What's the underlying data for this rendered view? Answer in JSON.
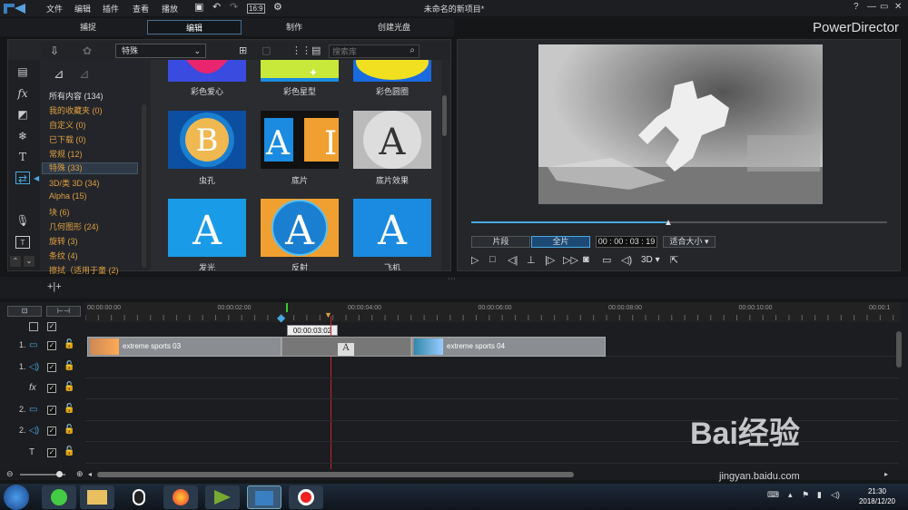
{
  "menu": {
    "file": "文件",
    "edit": "编辑",
    "plugins": "插件",
    "view": "查看",
    "playback": "播放"
  },
  "title": "未命名的新项目*",
  "window_controls": [
    "?",
    "—",
    "▭",
    "✕"
  ],
  "modes": {
    "capture": "捕捉",
    "edit": "编辑",
    "produce": "制作",
    "disc": "创建光盘"
  },
  "brand": "PowerDirector",
  "library": {
    "category_select": "特殊",
    "search_placeholder": "搜索库"
  },
  "categories": [
    {
      "label": "所有内容 (134)",
      "white": true
    },
    {
      "label": "我的收藏夹 (0)"
    },
    {
      "label": "自定义 (0)"
    },
    {
      "label": "已下载 (0)"
    },
    {
      "label": "常规 (12)"
    },
    {
      "label": "特殊 (33)",
      "selected": true
    },
    {
      "label": "3D/类 3D (34)"
    },
    {
      "label": "Alpha (15)"
    },
    {
      "label": "块 (6)"
    },
    {
      "label": "几何图形 (24)"
    },
    {
      "label": "旋转 (3)"
    },
    {
      "label": "条纹 (4)"
    },
    {
      "label": "擦拭（适用于童 (2)"
    }
  ],
  "thumbs": {
    "r1": [
      "彩色爱心",
      "彩色星型",
      "彩色圆圈"
    ],
    "r2": [
      "虫孔",
      "底片",
      "底片效果"
    ],
    "r3": [
      "发光",
      "反射",
      "飞机"
    ]
  },
  "preview": {
    "clip_btn": "片段",
    "full_btn": "全片",
    "timecode": "00 : 00 : 03 : 19",
    "fit": "适合大小",
    "d3": "3D",
    "progress": 0.47
  },
  "ruler": [
    "00:00:00:00",
    "00:00:02:00",
    "00:00:04:00",
    "00:00:06:00",
    "00:00:08:00",
    "00:00:10:00",
    "00:00:1"
  ],
  "timeline": {
    "cursor_time": "00:00:03:02",
    "clip1": "extreme sports 03",
    "clip2": "extreme sports 04",
    "transition_letter": "A"
  },
  "tracks": [
    {
      "num": "1."
    },
    {
      "num": "1."
    },
    {
      "num": ""
    },
    {
      "num": "2."
    },
    {
      "num": "2."
    },
    {
      "num": ""
    }
  ],
  "clock": {
    "time": "21:30",
    "date": "2018/12/20"
  },
  "watermark": {
    "main": "Bai经验",
    "sub": "jingyan.baidu.com"
  }
}
